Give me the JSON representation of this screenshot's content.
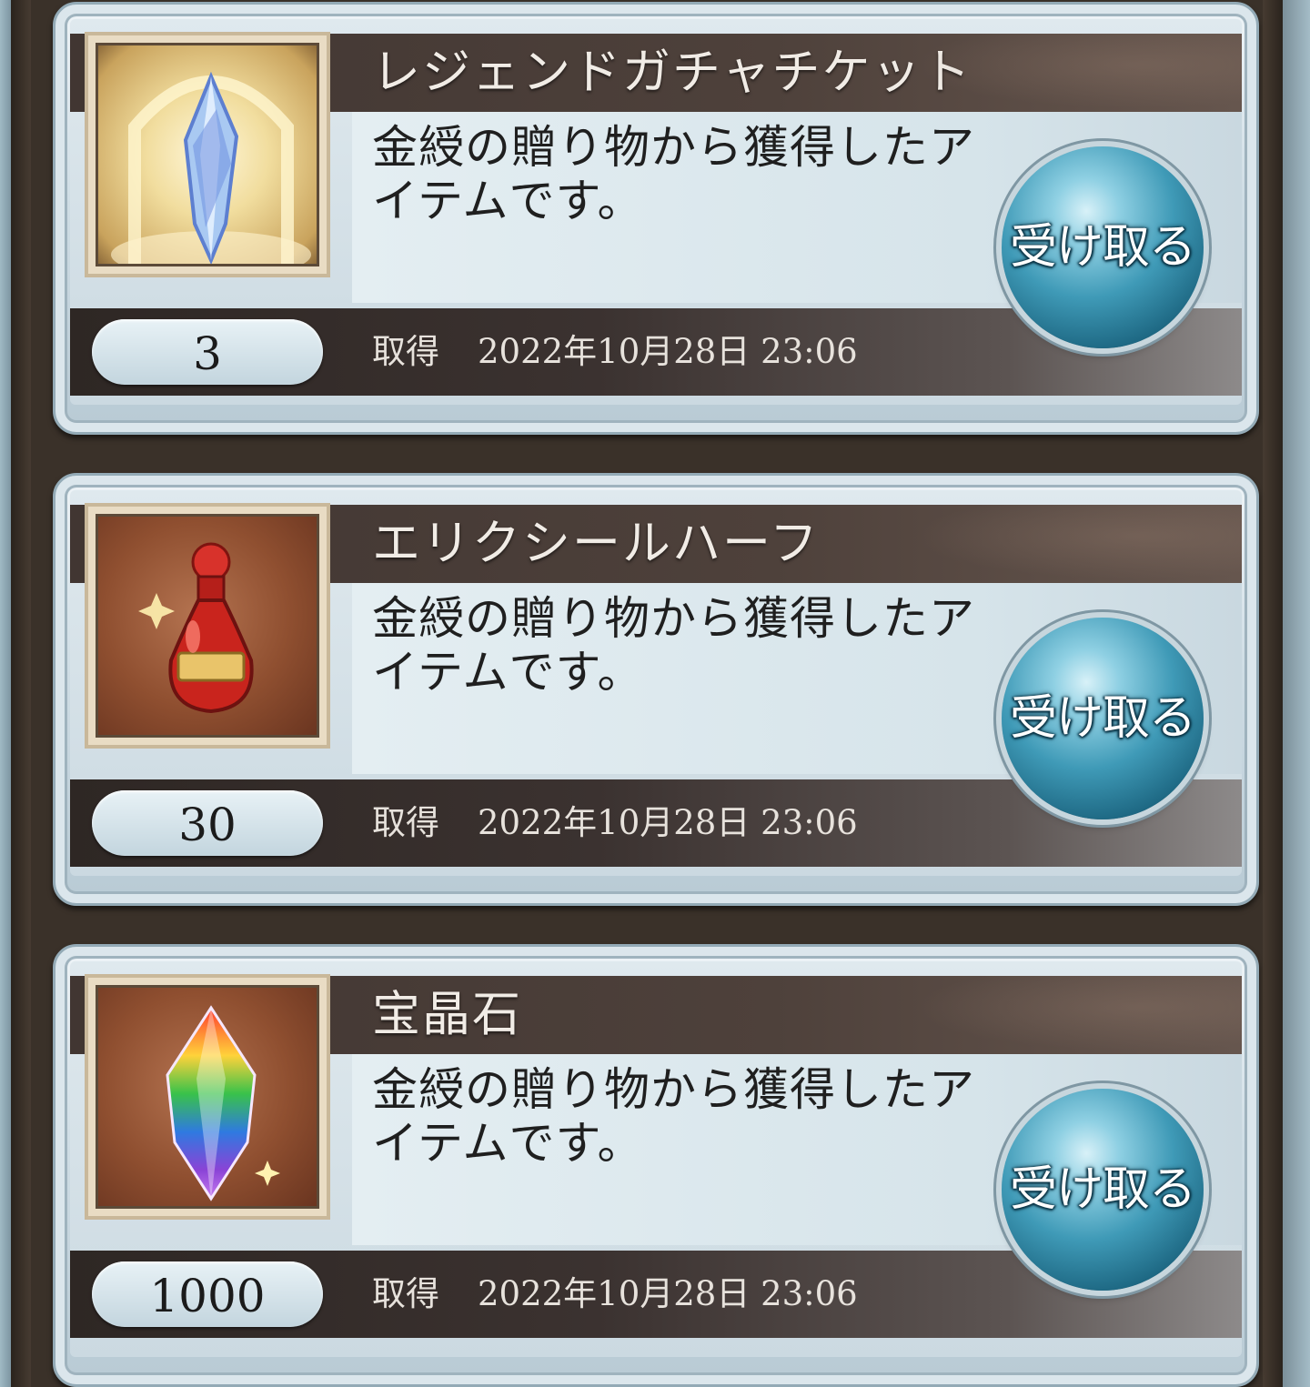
{
  "items": [
    {
      "name": "レジェンドガチャチケット",
      "description": "金綬の贈り物から獲得したアイテムです。",
      "quantity": "3",
      "acquired_label": "取得",
      "acquired_date": "2022年10月28日 23:06",
      "receive_label": "受け取る",
      "icon": "legend-gacha-ticket-icon"
    },
    {
      "name": "エリクシールハーフ",
      "description": "金綬の贈り物から獲得したアイテムです。",
      "quantity": "30",
      "acquired_label": "取得",
      "acquired_date": "2022年10月28日 23:06",
      "receive_label": "受け取る",
      "icon": "elixir-half-icon"
    },
    {
      "name": "宝晶石",
      "description": "金綬の贈り物から獲得したアイテムです。",
      "quantity": "1000",
      "acquired_label": "取得",
      "acquired_date": "2022年10月28日 23:06",
      "receive_label": "受け取る",
      "icon": "crystal-icon"
    }
  ]
}
